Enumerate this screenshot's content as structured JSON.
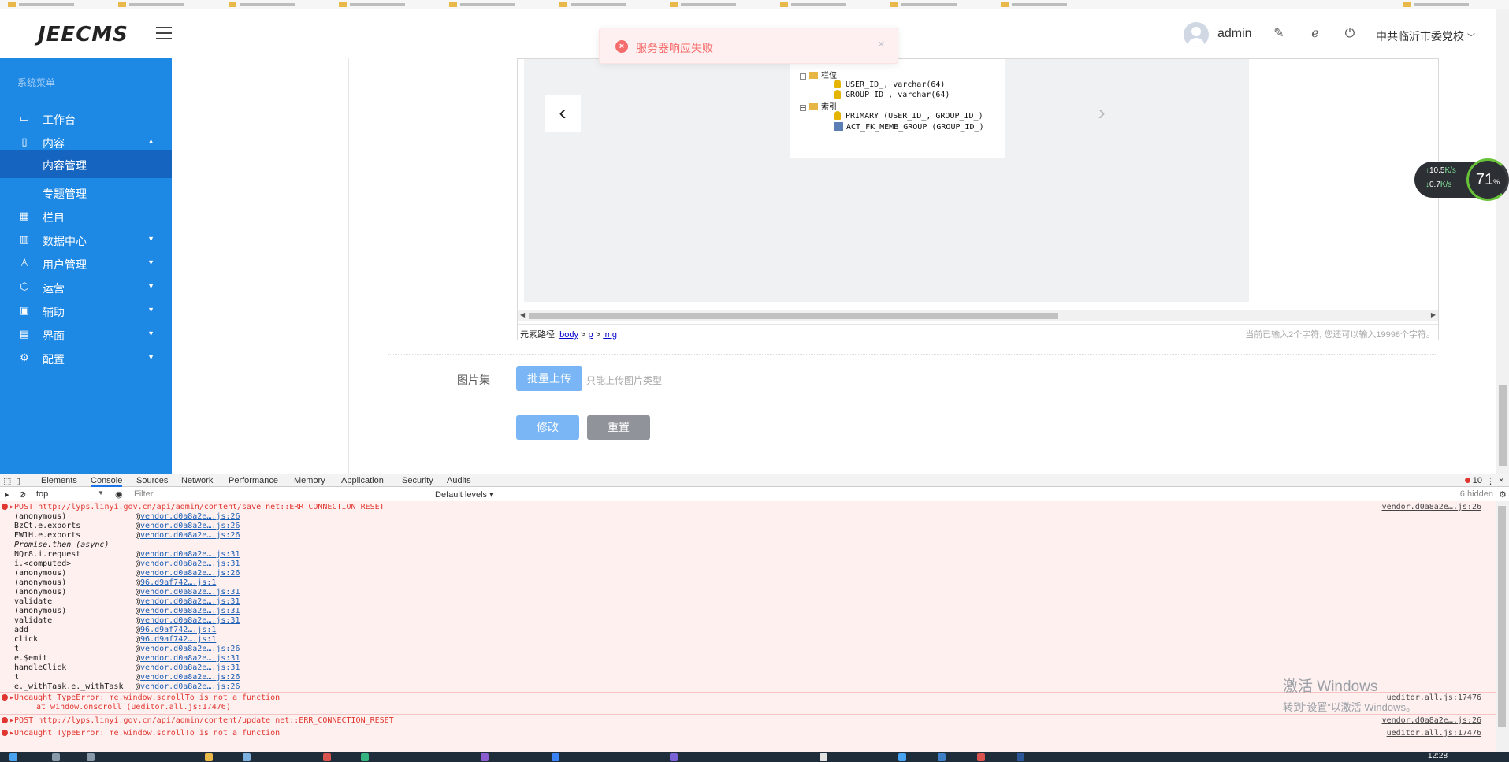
{
  "app": {
    "logo": "JEECMS",
    "user": "admin",
    "org": "中共临沂市委党校"
  },
  "toast": {
    "message": "服务器响应失败",
    "close": "×"
  },
  "sidebar": {
    "title": "系统菜单",
    "items": [
      {
        "label": "工作台",
        "icon": "monitor-icon",
        "glyph": "▭"
      },
      {
        "label": "内容",
        "icon": "document-icon",
        "glyph": "▯",
        "expanded": true
      },
      {
        "label": "内容管理",
        "sub": true,
        "active": true
      },
      {
        "label": "专题管理",
        "sub": true
      },
      {
        "label": "栏目",
        "icon": "grid-icon",
        "glyph": "▦"
      },
      {
        "label": "数据中心",
        "icon": "chart-icon",
        "glyph": "▥"
      },
      {
        "label": "用户管理",
        "icon": "user-icon",
        "glyph": "♙"
      },
      {
        "label": "运营",
        "icon": "shield-icon",
        "glyph": "⬡"
      },
      {
        "label": "辅助",
        "icon": "box-icon",
        "glyph": "▣"
      },
      {
        "label": "界面",
        "icon": "layout-icon",
        "glyph": "▤"
      },
      {
        "label": "配置",
        "icon": "gear-icon",
        "glyph": "⚙"
      }
    ]
  },
  "editor": {
    "image_lines": {
      "group_fields": "栏位",
      "field1": "USER_ID_, varchar(64)",
      "field2": "GROUP_ID_, varchar(64)",
      "group_index": "索引",
      "index1": "PRIMARY (USER_ID_, GROUP_ID_)",
      "index2": "ACT_FK_MEMB_GROUP (GROUP_ID_)"
    },
    "path_label": "元素路径:",
    "path": [
      "body",
      "p",
      "img"
    ],
    "path_sep": ">",
    "counter": "当前已输入2个字符, 您还可以输入19998个字符。"
  },
  "form": {
    "gallery_label": "图片集",
    "upload_button": "批量上传",
    "upload_hint": "只能上传图片类型",
    "submit_button": "修改",
    "reset_button": "重置"
  },
  "speed": {
    "up": "10.5",
    "up_unit": "K/s",
    "down": "0.7",
    "down_unit": "K/s",
    "percent": "71",
    "percent_unit": "%"
  },
  "devtools": {
    "tabs": [
      "Elements",
      "Console",
      "Sources",
      "Network",
      "Performance",
      "Memory",
      "Application",
      "Security",
      "Audits"
    ],
    "selected_tab": "Console",
    "error_count": "10",
    "context": "top",
    "filter_placeholder": "Filter",
    "levels": "Default levels",
    "hidden": "6 hidden",
    "error1": {
      "method": "POST",
      "url": "http://lyps.linyi.gov.cn/api/admin/content/save",
      "msg": "net::ERR_CONNECTION_RESET",
      "source": "vendor.d0a8a2e….js:26"
    },
    "stack": [
      {
        "fn": "(anonymous)",
        "loc": "vendor.d0a8a2e….js:26"
      },
      {
        "fn": "BzCt.e.exports",
        "loc": "vendor.d0a8a2e….js:26"
      },
      {
        "fn": "EW1H.e.exports",
        "loc": "vendor.d0a8a2e….js:26"
      },
      {
        "fn": "Promise.then (async)",
        "loc": ""
      },
      {
        "fn": "NQr8.i.request",
        "loc": "vendor.d0a8a2e….js:31"
      },
      {
        "fn": "i.<computed>",
        "loc": "vendor.d0a8a2e….js:31"
      },
      {
        "fn": "(anonymous)",
        "loc": "vendor.d0a8a2e….js:26"
      },
      {
        "fn": "(anonymous)",
        "loc": "96.d9af742….js:1"
      },
      {
        "fn": "(anonymous)",
        "loc": "vendor.d0a8a2e….js:31"
      },
      {
        "fn": "validate",
        "loc": "vendor.d0a8a2e….js:31"
      },
      {
        "fn": "(anonymous)",
        "loc": "vendor.d0a8a2e….js:31"
      },
      {
        "fn": "validate",
        "loc": "vendor.d0a8a2e….js:31"
      },
      {
        "fn": "add",
        "loc": "96.d9af742….js:1"
      },
      {
        "fn": "click",
        "loc": "96.d9af742….js:1"
      },
      {
        "fn": "t",
        "loc": "vendor.d0a8a2e….js:26"
      },
      {
        "fn": "e.$emit",
        "loc": "vendor.d0a8a2e….js:31"
      },
      {
        "fn": "handleClick",
        "loc": "vendor.d0a8a2e….js:31"
      },
      {
        "fn": "t",
        "loc": "vendor.d0a8a2e….js:26"
      },
      {
        "fn": "e._withTask.e._withTask",
        "loc": "vendor.d0a8a2e….js:26"
      }
    ],
    "error2": {
      "msg": "Uncaught TypeError: me.window.scrollTo is not a function",
      "at": "at window.onscroll (ueditor.all.js:17476)",
      "source": "ueditor.all.js:17476"
    },
    "error3": {
      "method": "POST",
      "url": "http://lyps.linyi.gov.cn/api/admin/content/update",
      "msg": "net::ERR_CONNECTION_RESET",
      "source": "vendor.d0a8a2e….js:26"
    },
    "error4": {
      "msg": "Uncaught TypeError: me.window.scrollTo is not a function",
      "source": "ueditor.all.js:17476"
    }
  },
  "watermark": {
    "line1": "激活 Windows",
    "line2": "转到“设置”以激活 Windows。"
  },
  "taskbar": {
    "time": "12:28"
  }
}
